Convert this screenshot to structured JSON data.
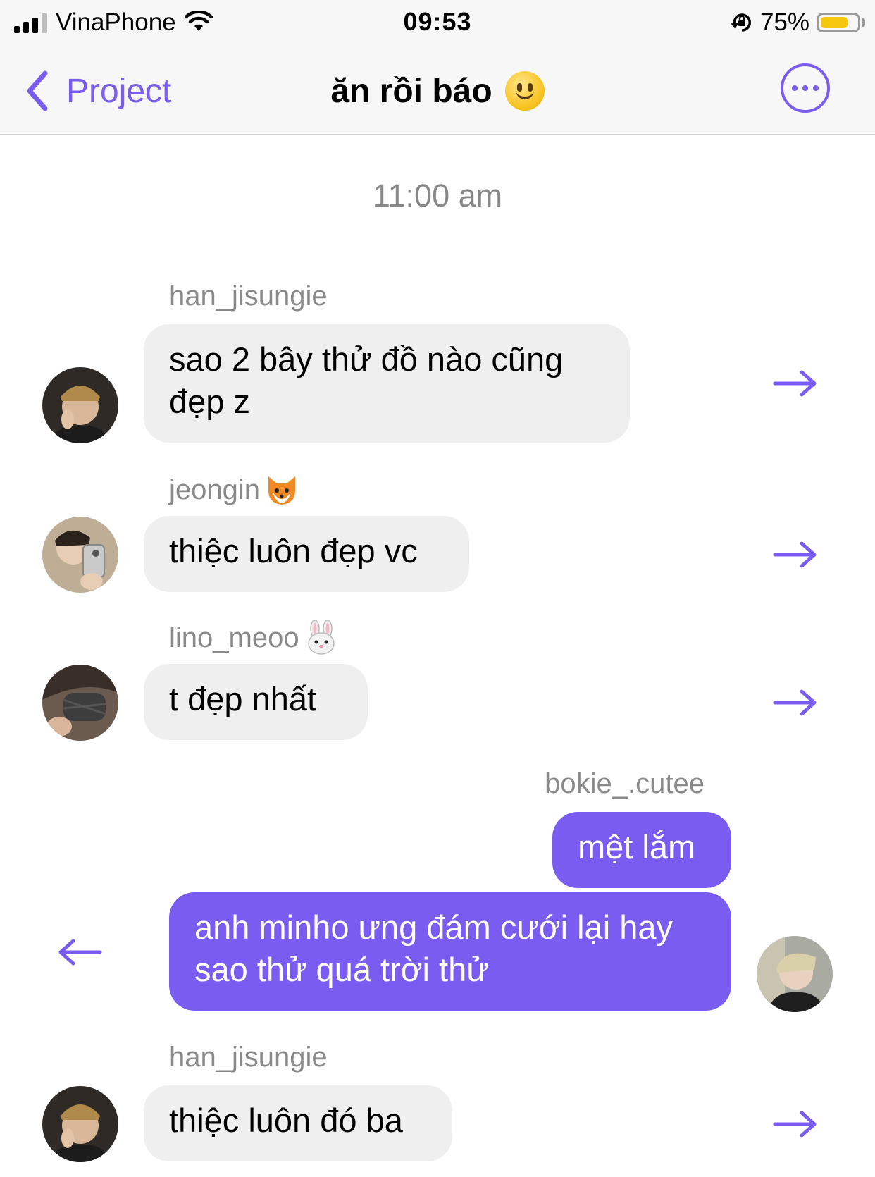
{
  "status_bar": {
    "carrier": "VinaPhone",
    "time": "09:53",
    "battery_percent": "75%",
    "battery_level": 0.75,
    "battery_color": "#f6c90e"
  },
  "nav": {
    "back_label": "Project",
    "title": "ăn rồi báo",
    "title_emoji_icon": "slightly-smiling-face-icon",
    "more_icon": "more-options-icon",
    "accent_color": "#7b5cf0"
  },
  "timestamp": "11:00 am",
  "messages": [
    {
      "sender": "han_jisungie",
      "text": "sao 2 bây thử đồ nào cũng đẹp z",
      "direction": "incoming",
      "action_icon": "forward-arrow-icon"
    },
    {
      "sender": "jeongin",
      "sender_emoji_icon": "fox-icon",
      "text": "thiệc luôn đẹp vc",
      "direction": "incoming",
      "action_icon": "forward-arrow-icon"
    },
    {
      "sender": "lino_meoo",
      "sender_emoji_icon": "rabbit-icon",
      "text": "t đẹp nhất",
      "direction": "incoming",
      "action_icon": "forward-arrow-icon"
    },
    {
      "sender": "bokie_.cutee",
      "text": "mệt lắm",
      "direction": "outgoing"
    },
    {
      "text": "anh minho ưng đám cưới lại hay sao thử quá trời thử",
      "direction": "outgoing",
      "action_icon": "back-arrow-icon"
    },
    {
      "sender": "han_jisungie",
      "text": "thiệc luôn đó ba",
      "direction": "incoming",
      "action_icon": "forward-arrow-icon"
    }
  ],
  "colors": {
    "outgoing_bubble": "#7a5cf0",
    "incoming_bubble": "#efefef"
  }
}
